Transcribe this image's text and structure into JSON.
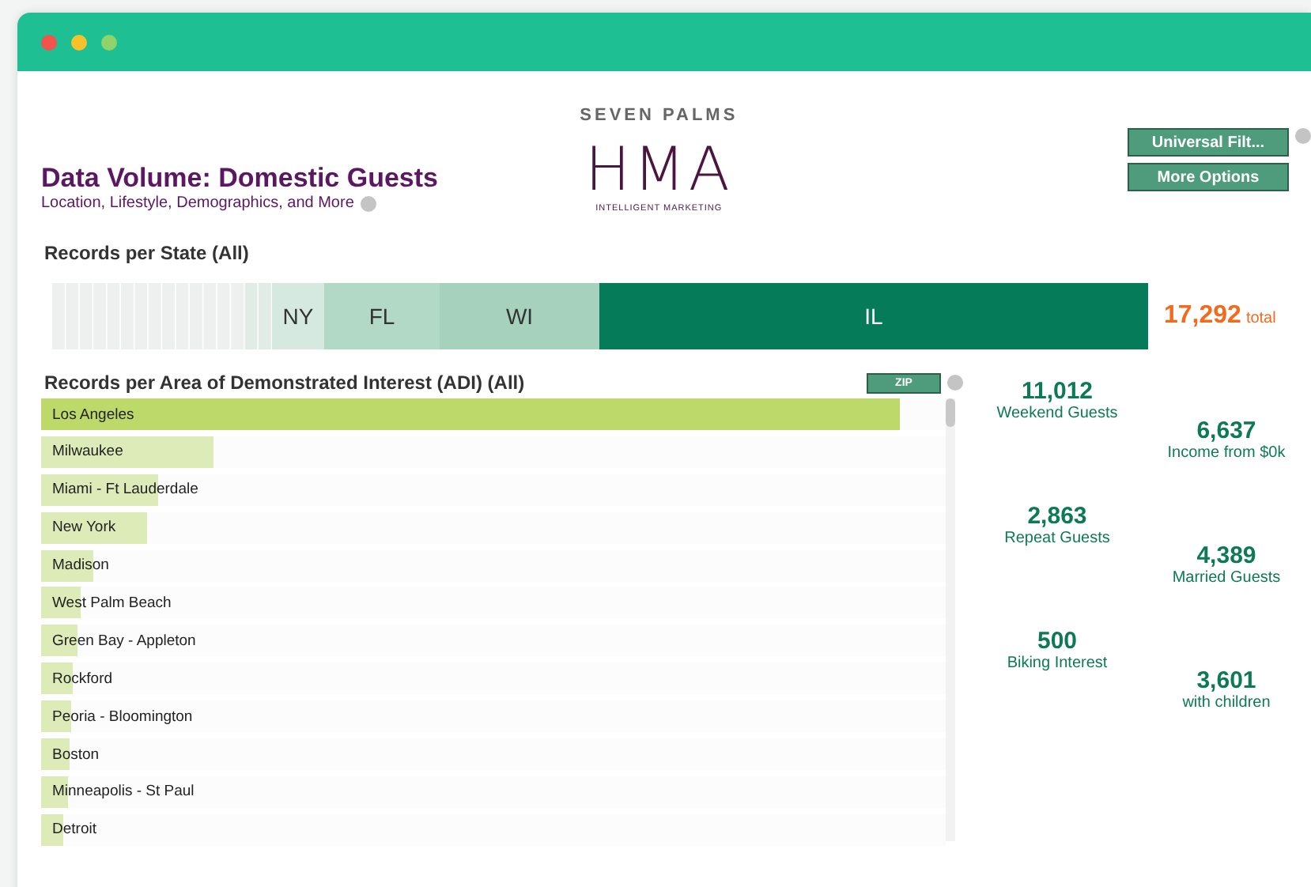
{
  "brand": {
    "name": "SEVEN PALMS",
    "logo": "HMA",
    "tagline": "INTELLIGENT MARKETING"
  },
  "title": "Data Volume: Domestic Guests",
  "subtitle": "Location, Lifestyle, Demographics, and More",
  "buttons": [
    "Universal Filt...",
    "More Options"
  ],
  "states": {
    "title": "Records per State (All)",
    "total": "17,292",
    "total_label": "total",
    "segments": [
      {
        "label": "NY",
        "color": "#d6e9e0"
      },
      {
        "label": "FL",
        "color": "#b2d8c6"
      },
      {
        "label": "WI",
        "color": "#a6d1bd"
      },
      {
        "label": "IL",
        "color": "#067b5a"
      }
    ]
  },
  "adi": {
    "title": "Records per Area of Demonstrated Interest (ADI) (All)",
    "zip_button": "ZIP",
    "rows": [
      {
        "name": "Los Angeles",
        "level": 0.95,
        "selected": true
      },
      {
        "name": "Milwaukee",
        "level": 0.19,
        "selected": false
      },
      {
        "name": "Miami - Ft Lauderdale",
        "level": 0.13,
        "selected": false
      },
      {
        "name": "New York",
        "level": 0.117,
        "selected": false
      },
      {
        "name": "Madison",
        "level": 0.058,
        "selected": false
      },
      {
        "name": "West Palm Beach",
        "level": 0.044,
        "selected": false
      },
      {
        "name": "Green Bay - Appleton",
        "level": 0.04,
        "selected": false
      },
      {
        "name": "Rockford",
        "level": 0.035,
        "selected": false
      },
      {
        "name": "Peoria - Bloomington",
        "level": 0.033,
        "selected": false
      },
      {
        "name": "Boston",
        "level": 0.031,
        "selected": false
      },
      {
        "name": "Minneapolis - St Paul",
        "level": 0.03,
        "selected": false
      },
      {
        "name": "Detroit",
        "level": 0.024,
        "selected": false
      }
    ]
  },
  "stats": [
    [
      {
        "value": "11,012",
        "label": "Weekend Guests"
      },
      {
        "value": "2,863",
        "label": "Repeat Guests"
      },
      {
        "value": "500",
        "label": "Biking Interest"
      }
    ],
    [
      {
        "value": "6,637",
        "label": "Income from $0k"
      },
      {
        "value": "4,389",
        "label": "Married Guests"
      },
      {
        "value": "3,601",
        "label": "with children"
      }
    ]
  ]
}
